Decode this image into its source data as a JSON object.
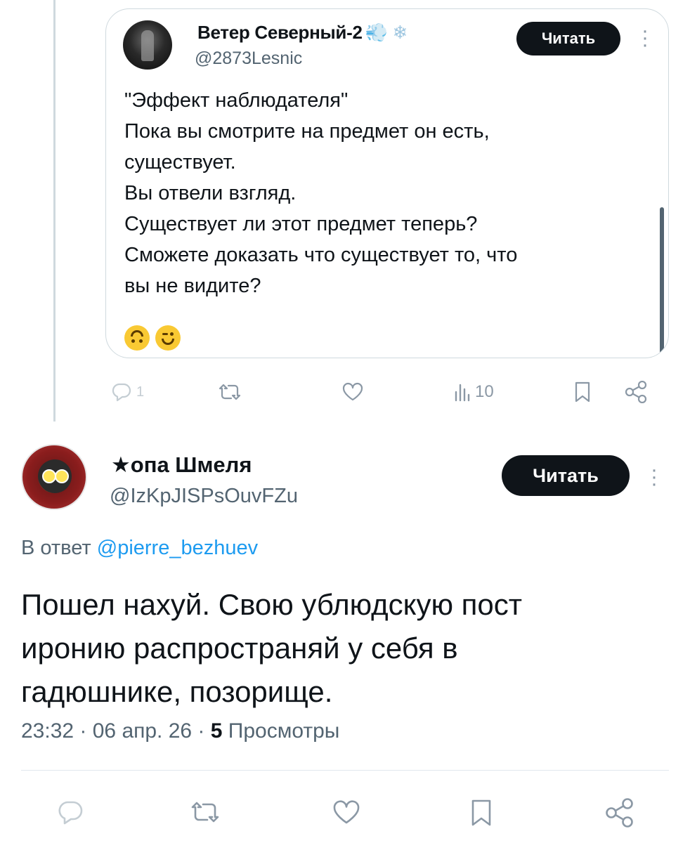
{
  "parent": {
    "name": "Ветер Северный-2",
    "name_deco": "💨 ❄",
    "handle": "@2873Lesnic",
    "read_button": "Читать",
    "body_lines": [
      "\"Эффект наблюдателя\"",
      "Пока вы смотрите на предмет он есть,",
      "существует.",
      "Вы отвели взгляд.",
      "Существует ли этот предмет теперь?",
      "Сможете доказать что существует то, что",
      "вы не видите?"
    ],
    "emojis": [
      "upside-down-face-emoji",
      "winking-face-emoji"
    ],
    "actions": {
      "reply_count": "1",
      "views_count": "10"
    }
  },
  "reply": {
    "name": "★опа Шмеля",
    "handle": "@IzKpJISPsOuvFZu",
    "read_button": "Читать",
    "reply_prefix": "В ответ",
    "reply_target": "@pierre_bezhuev",
    "text_lines": [
      "Пошел нахуй. Свою ублюдскую пост",
      "иронию распространяй у себя в",
      "гадюшнике, позорище."
    ],
    "meta": {
      "time_date": "23:32 · 06 апр. 26 · ",
      "views_count": "5",
      "views_label": " Просмотры"
    }
  },
  "colors": {
    "text": "#0f1419",
    "muted": "#536471",
    "link": "#1d9bf0",
    "button_bg": "#0f1419",
    "icon": "#8b98a5"
  }
}
